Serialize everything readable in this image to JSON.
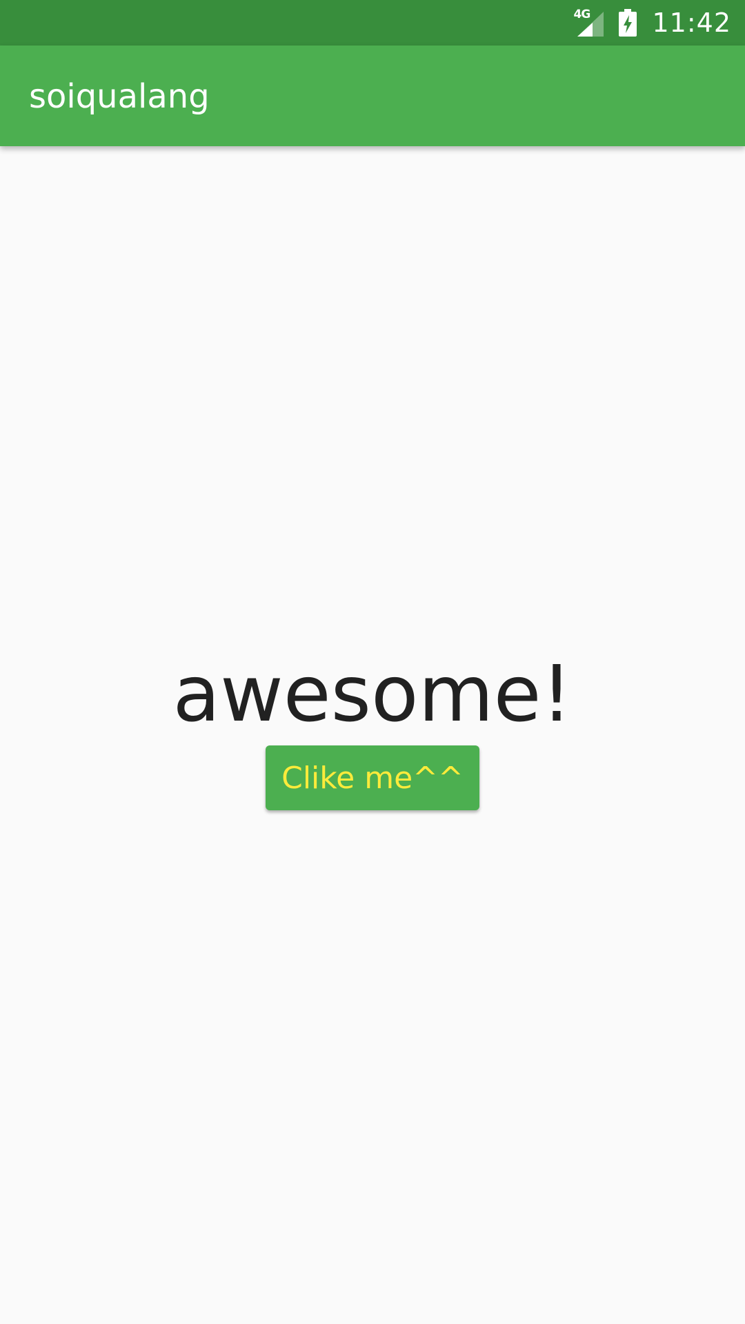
{
  "status_bar": {
    "network_type": "4G",
    "time": "11:42",
    "background_color": "#388e3c"
  },
  "app_bar": {
    "title": "soiqualang",
    "background_color": "#4caf50"
  },
  "main": {
    "headline": "awesome!",
    "button_label": "Clike me^^",
    "button_color": "#4caf50",
    "button_text_color": "#ffeb3b"
  }
}
